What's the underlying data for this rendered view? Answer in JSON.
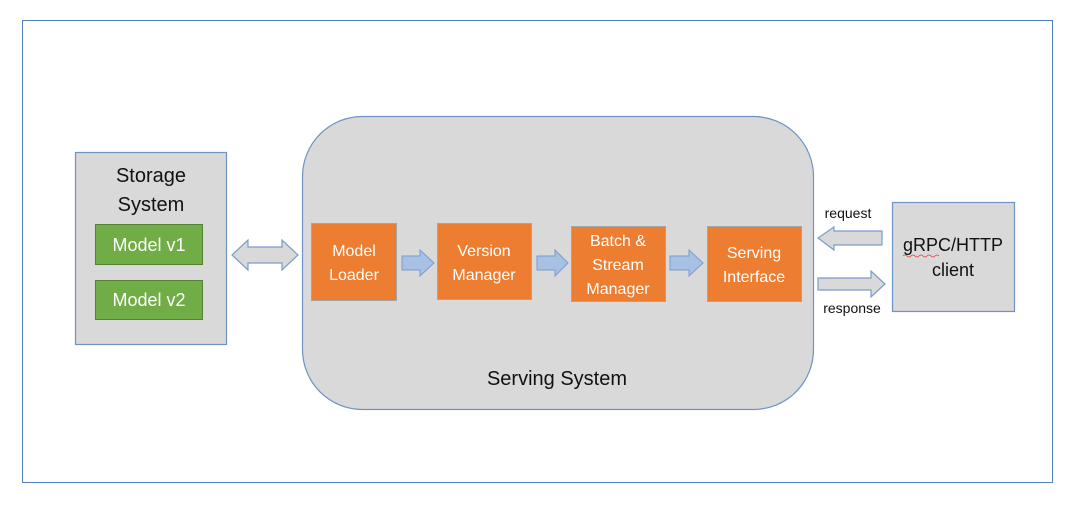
{
  "colors": {
    "frame": "#4f81bd",
    "box_fill": "#d9d9d9",
    "box_stroke": "#6f93c4",
    "model_green": "#70ad47",
    "component_orange": "#ed7d31",
    "flow_arrow_blue": "#a6c1e4",
    "io_arrow_gray": "#d9d9d9"
  },
  "storage": {
    "title_line1": "Storage",
    "title_line2": "System",
    "models": [
      "Model v1",
      "Model v2"
    ]
  },
  "serving_system": {
    "label": "Serving System",
    "components": [
      {
        "line1": "Model",
        "line2": "Loader"
      },
      {
        "line1": "Version",
        "line2": "Manager"
      },
      {
        "line1": "Batch &",
        "line2": "Stream",
        "line3": "Manager"
      },
      {
        "line1": "Serving",
        "line2": "Interface"
      }
    ]
  },
  "client": {
    "line1": "gRPC/HTTP",
    "line2": "client"
  },
  "arrows": {
    "request_label": "request",
    "response_label": "response"
  }
}
